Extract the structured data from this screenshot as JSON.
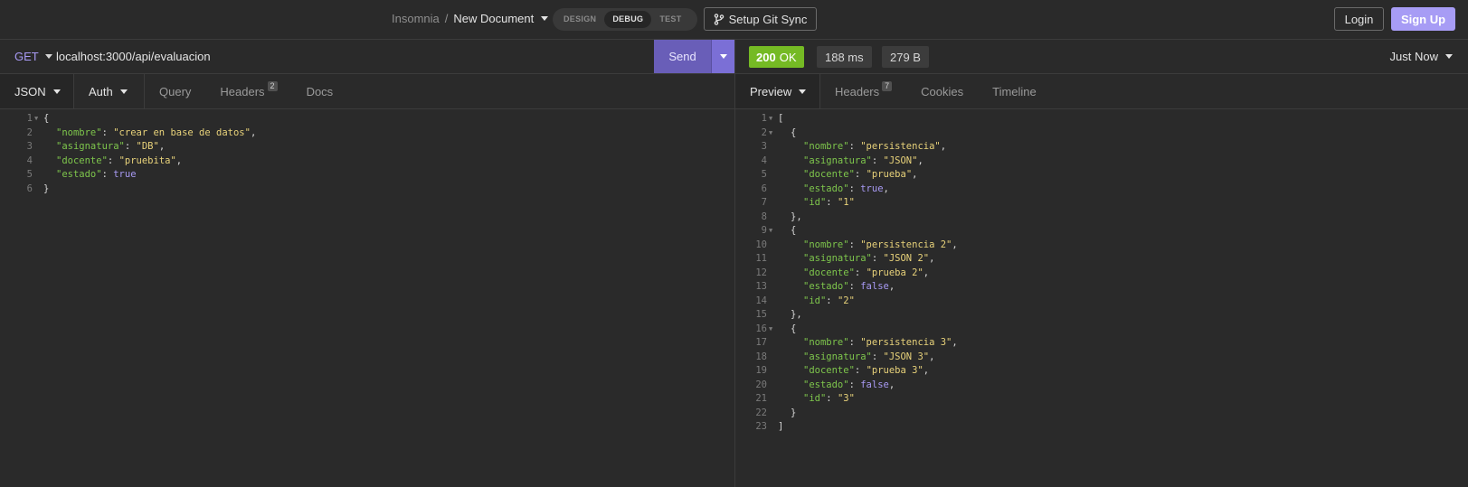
{
  "header": {
    "app_name": "Insomnia",
    "separator": "/",
    "document_name": "New Document",
    "modes": [
      "DESIGN",
      "DEBUG",
      "TEST"
    ],
    "active_mode": "DEBUG",
    "git_sync_label": "Setup Git Sync",
    "login_label": "Login",
    "signup_label": "Sign Up"
  },
  "request": {
    "method": "GET",
    "url": "localhost:3000/api/evaluacion",
    "send_label": "Send",
    "tabs": {
      "body": "JSON",
      "auth": "Auth",
      "query": "Query",
      "headers": "Headers",
      "headers_count": "2",
      "docs": "Docs"
    },
    "body_lines": [
      {
        "n": "1",
        "fold": true,
        "text": "{"
      },
      {
        "n": "2",
        "key": "\"nombre\"",
        "val": "\"crear en base de datos\"",
        "vt": "s",
        "tail": ","
      },
      {
        "n": "3",
        "key": "\"asignatura\"",
        "val": "\"DB\"",
        "vt": "s",
        "tail": ","
      },
      {
        "n": "4",
        "key": "\"docente\"",
        "val": "\"pruebita\"",
        "vt": "s",
        "tail": ","
      },
      {
        "n": "5",
        "key": "\"estado\"",
        "val": "true",
        "vt": "b",
        "tail": ""
      },
      {
        "n": "6",
        "text": "}"
      }
    ]
  },
  "response": {
    "status_code": "200",
    "status_text": "OK",
    "time": "188 ms",
    "size": "279 B",
    "history_label": "Just Now",
    "tabs": {
      "preview": "Preview",
      "headers": "Headers",
      "headers_count": "7",
      "cookies": "Cookies",
      "timeline": "Timeline"
    },
    "body_lines": [
      {
        "n": "1",
        "fold": true,
        "text": "["
      },
      {
        "n": "2",
        "fold": true,
        "indent": 1,
        "text": "{"
      },
      {
        "n": "3",
        "indent": 2,
        "key": "\"nombre\"",
        "val": "\"persistencia\"",
        "vt": "s",
        "tail": ","
      },
      {
        "n": "4",
        "indent": 2,
        "key": "\"asignatura\"",
        "val": "\"JSON\"",
        "vt": "s",
        "tail": ","
      },
      {
        "n": "5",
        "indent": 2,
        "key": "\"docente\"",
        "val": "\"prueba\"",
        "vt": "s",
        "tail": ","
      },
      {
        "n": "6",
        "indent": 2,
        "key": "\"estado\"",
        "val": "true",
        "vt": "b",
        "tail": ","
      },
      {
        "n": "7",
        "indent": 2,
        "key": "\"id\"",
        "val": "\"1\"",
        "vt": "s",
        "tail": ""
      },
      {
        "n": "8",
        "indent": 1,
        "text": "},"
      },
      {
        "n": "9",
        "fold": true,
        "indent": 1,
        "text": "{"
      },
      {
        "n": "10",
        "indent": 2,
        "key": "\"nombre\"",
        "val": "\"persistencia 2\"",
        "vt": "s",
        "tail": ","
      },
      {
        "n": "11",
        "indent": 2,
        "key": "\"asignatura\"",
        "val": "\"JSON 2\"",
        "vt": "s",
        "tail": ","
      },
      {
        "n": "12",
        "indent": 2,
        "key": "\"docente\"",
        "val": "\"prueba 2\"",
        "vt": "s",
        "tail": ","
      },
      {
        "n": "13",
        "indent": 2,
        "key": "\"estado\"",
        "val": "false",
        "vt": "b",
        "tail": ","
      },
      {
        "n": "14",
        "indent": 2,
        "key": "\"id\"",
        "val": "\"2\"",
        "vt": "s",
        "tail": ""
      },
      {
        "n": "15",
        "indent": 1,
        "text": "},"
      },
      {
        "n": "16",
        "fold": true,
        "indent": 1,
        "text": "{"
      },
      {
        "n": "17",
        "indent": 2,
        "key": "\"nombre\"",
        "val": "\"persistencia 3\"",
        "vt": "s",
        "tail": ","
      },
      {
        "n": "18",
        "indent": 2,
        "key": "\"asignatura\"",
        "val": "\"JSON 3\"",
        "vt": "s",
        "tail": ","
      },
      {
        "n": "19",
        "indent": 2,
        "key": "\"docente\"",
        "val": "\"prueba 3\"",
        "vt": "s",
        "tail": ","
      },
      {
        "n": "20",
        "indent": 2,
        "key": "\"estado\"",
        "val": "false",
        "vt": "b",
        "tail": ","
      },
      {
        "n": "21",
        "indent": 2,
        "key": "\"id\"",
        "val": "\"3\"",
        "vt": "s",
        "tail": ""
      },
      {
        "n": "22",
        "indent": 1,
        "text": "}"
      },
      {
        "n": "23",
        "text": "]"
      }
    ]
  },
  "colors": {
    "accent": "#a89af4",
    "send": "#695eb8",
    "status_ok": "#75ba24",
    "json_key": "#7ec64c",
    "json_string": "#e8d27a",
    "json_bool": "#a89af4"
  },
  "icons": {
    "git": "git-branch-icon",
    "dropdown": "chevron-down-icon",
    "fold": "fold-arrow-icon"
  }
}
